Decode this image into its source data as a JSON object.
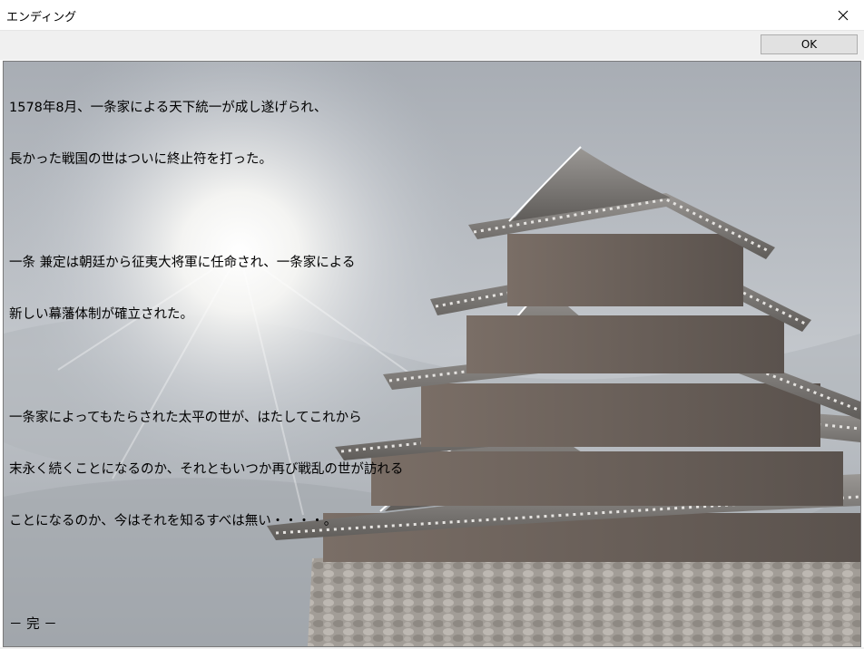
{
  "window": {
    "title": "エンディング",
    "close_label": "×"
  },
  "toolbar": {
    "ok_label": "OK"
  },
  "message": {
    "paragraphs": [
      [
        "1578年8月、一条家による天下統一が成し遂げられ、",
        "長かった戦国の世はついに終止符を打った。"
      ],
      [
        "一条 兼定は朝廷から征夷大将軍に任命され、一条家による",
        "新しい幕藩体制が確立された。"
      ],
      [
        "一条家によってもたらされた太平の世が、はたしてこれから",
        "末永く続くことになるのか、それともいつか再び戦乱の世が訪れる",
        "ことになるのか、今はそれを知るすべは無い・・・・。"
      ],
      [
        "－ 完 －"
      ]
    ]
  },
  "background": {
    "subject": "castle-tenshu-illustration",
    "sky_color": "#b9bfc6",
    "roof_color": "#7d7b78",
    "wall_color": "#6a625c",
    "stone_color": "#9a9590"
  }
}
